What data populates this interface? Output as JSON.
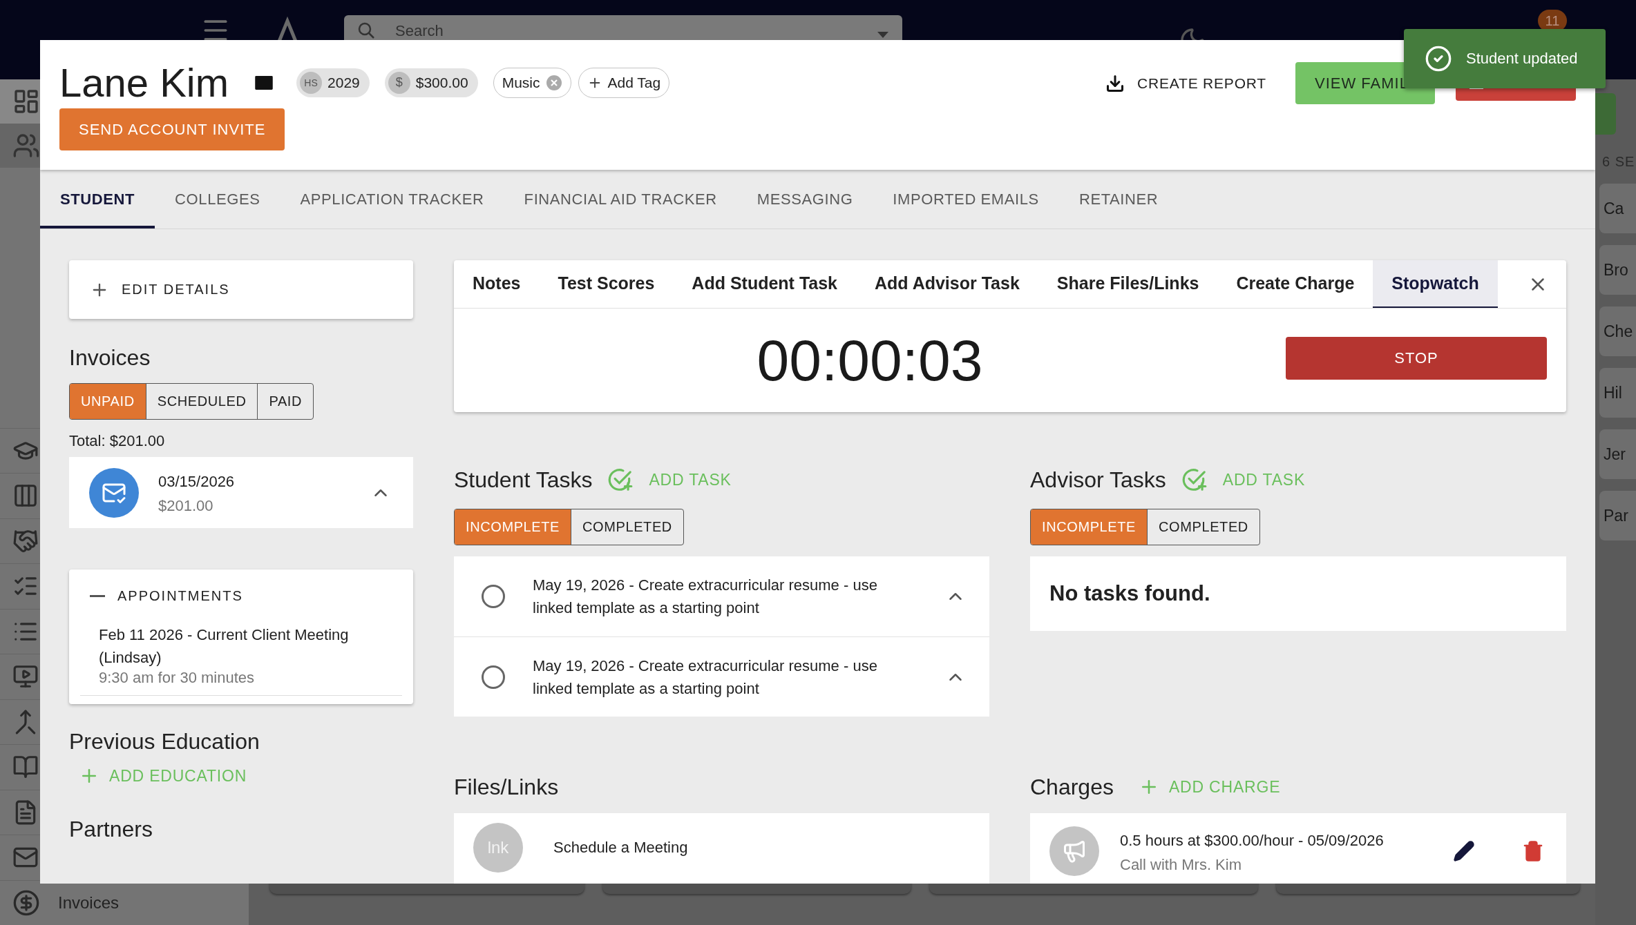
{
  "topbar": {
    "search": {
      "placeholder": "Search"
    },
    "notification_count": "11"
  },
  "sidebar": {
    "items": [
      {
        "label": "Invoices"
      }
    ]
  },
  "background": {
    "section_label": "6 SE",
    "cards": [
      "Ca",
      "Bro",
      "Che",
      "Hil",
      "Jer",
      "Par"
    ]
  },
  "modal": {
    "header": {
      "name": "Lane Kim",
      "chips": [
        {
          "kind": "year",
          "prefix": "HS",
          "label": "2029"
        },
        {
          "kind": "rate",
          "prefix": "$",
          "label": "$300.00"
        }
      ],
      "tags": [
        {
          "kind": "tag",
          "label": "Music"
        },
        {
          "kind": "add",
          "label": "Add Tag"
        }
      ],
      "invite_button": "SEND ACCOUNT INVITE",
      "create_report": "CREATE REPORT",
      "view_family": "VIEW FAMIL"
    },
    "tabs": [
      {
        "label": "STUDENT",
        "selected": true
      },
      {
        "label": "COLLEGES",
        "selected": false
      },
      {
        "label": "APPLICATION TRACKER",
        "selected": false
      },
      {
        "label": "FINANCIAL AID TRACKER",
        "selected": false
      },
      {
        "label": "MESSAGING",
        "selected": false
      },
      {
        "label": "IMPORTED EMAILS",
        "selected": false
      },
      {
        "label": "RETAINER",
        "selected": false
      }
    ],
    "edit_details": "EDIT DETAILS",
    "invoices": {
      "title": "Invoices",
      "filters": [
        {
          "label": "UNPAID",
          "selected": true
        },
        {
          "label": "SCHEDULED",
          "selected": false
        },
        {
          "label": "PAID",
          "selected": false
        }
      ],
      "total": "Total: $201.00",
      "items": [
        {
          "date": "03/15/2026",
          "amount": "$201.00",
          "expanded": true
        }
      ]
    },
    "appointments": {
      "title": "APPOINTMENTS",
      "expanded": true,
      "items": [
        {
          "title": "Feb 11 2026 - Current Client Meeting (Lindsay)",
          "detail": "9:30 am for 30 minutes"
        }
      ]
    },
    "previous_education": {
      "title": "Previous Education",
      "add": "ADD EDUCATION"
    },
    "partners": {
      "title": "Partners"
    },
    "action_panel": {
      "tabs": [
        {
          "label": "Notes",
          "selected": false
        },
        {
          "label": "Test Scores",
          "selected": false
        },
        {
          "label": "Add Student Task",
          "selected": false
        },
        {
          "label": "Add Advisor Task",
          "selected": false
        },
        {
          "label": "Share Files/Links",
          "selected": false
        },
        {
          "label": "Create Charge",
          "selected": false
        },
        {
          "label": "Stopwatch",
          "selected": true
        }
      ],
      "stopwatch": {
        "time": "00:00:03",
        "button": "STOP"
      }
    },
    "student_tasks": {
      "title": "Student Tasks",
      "add": "ADD TASK",
      "filters": [
        {
          "label": "INCOMPLETE",
          "selected": true
        },
        {
          "label": "COMPLETED",
          "selected": false
        }
      ],
      "tasks": [
        {
          "text": "May 19, 2026 - Create extracurricular resume - use linked template as a starting point",
          "checked": false,
          "expanded": true
        },
        {
          "text": "May 19, 2026 - Create extracurricular resume - use linked template as a starting point",
          "checked": false,
          "expanded": true
        }
      ]
    },
    "advisor_tasks": {
      "title": "Advisor Tasks",
      "add": "ADD TASK",
      "filters": [
        {
          "label": "INCOMPLETE",
          "selected": true
        },
        {
          "label": "COMPLETED",
          "selected": false
        }
      ],
      "empty": "No tasks found."
    },
    "files": {
      "title": "Files/Links",
      "items": [
        {
          "avatar": "lnk",
          "label": "Schedule a Meeting"
        }
      ]
    },
    "charges": {
      "title": "Charges",
      "add": "ADD CHARGE",
      "items": [
        {
          "title": "0.5 hours at $300.00/hour - 05/09/2026",
          "subtitle": "Call with Mrs. Kim"
        }
      ]
    }
  },
  "toast": {
    "message": "Student updated"
  }
}
